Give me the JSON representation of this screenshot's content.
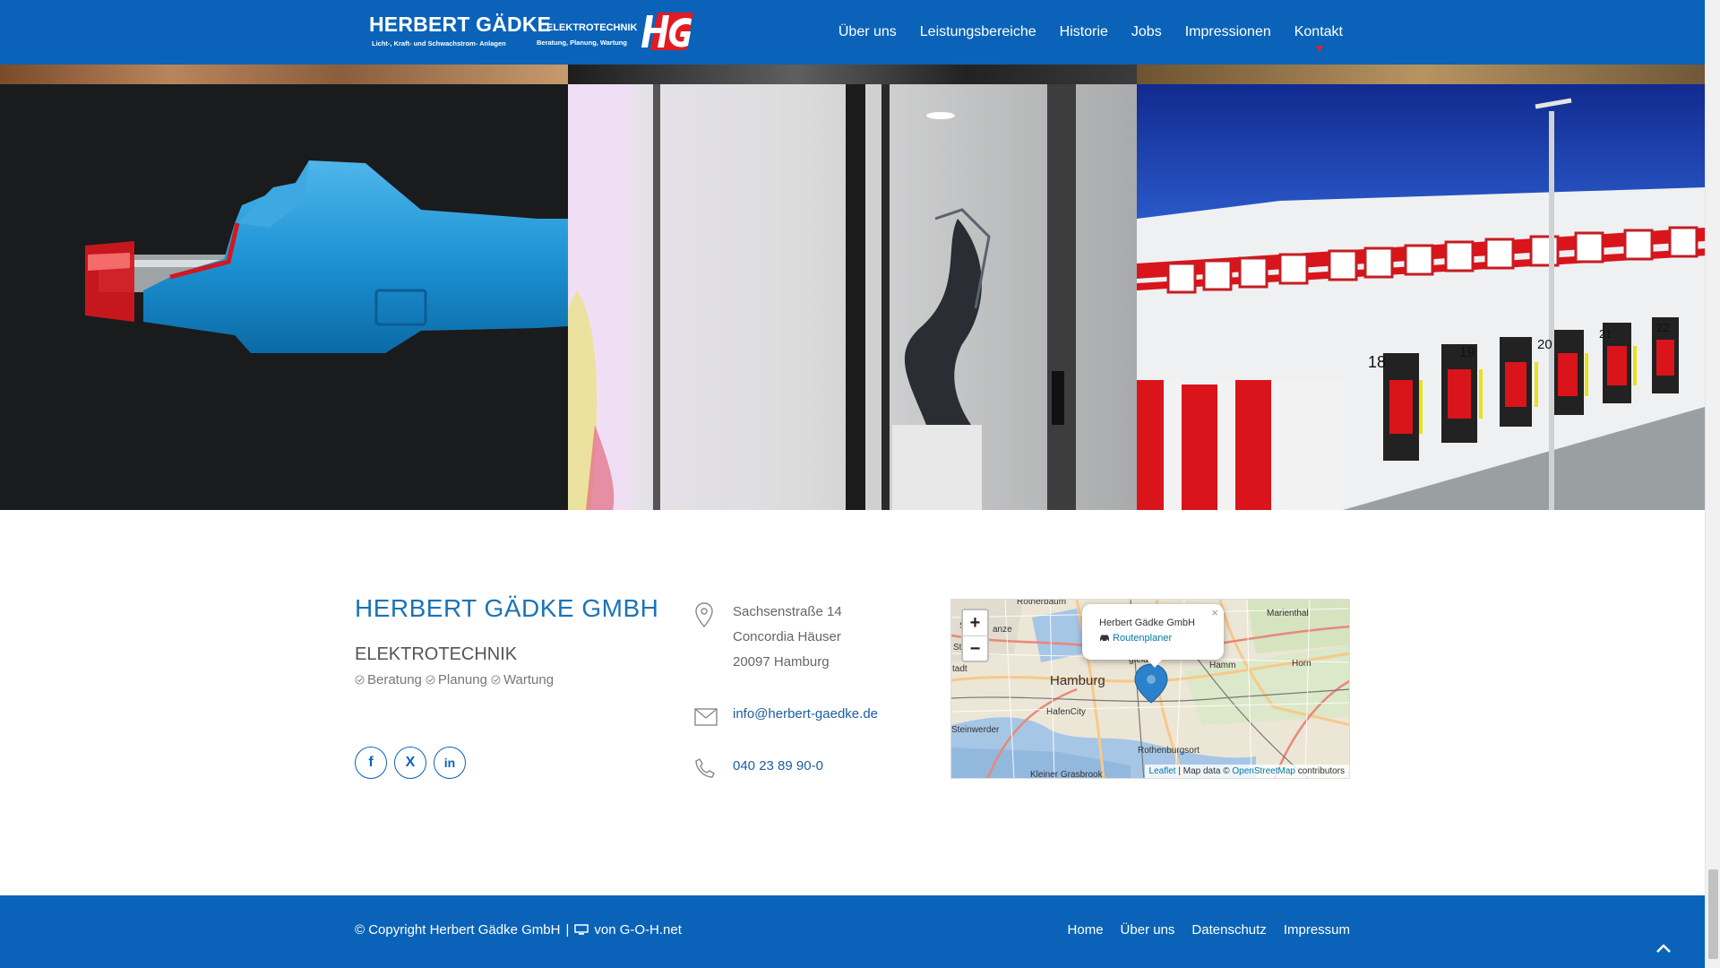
{
  "header": {
    "logo": {
      "brand": "HERBERT GÄDKE",
      "brand_sub": "Licht-, Kraft- und Schwachstrom- Anlagen",
      "elektro": "ELEKTROTECHNIK",
      "elektro_sub": "Beratung, Planung, Wartung"
    },
    "nav": [
      {
        "label": "Über uns",
        "active": false
      },
      {
        "label": "Leistungsbereiche",
        "active": false
      },
      {
        "label": "Historie",
        "active": false
      },
      {
        "label": "Jobs",
        "active": false
      },
      {
        "label": "Impressionen",
        "active": false
      },
      {
        "label": "Kontakt",
        "active": true
      }
    ],
    "accent": "#0a63b8",
    "active_marker_color": "#e02323"
  },
  "gallery": {
    "dock_numbers": [
      "18",
      "19",
      "20",
      "21",
      "22"
    ]
  },
  "footer": {
    "company_name": "HERBERT GÄDKE GMBH",
    "subtitle": "ELEKTROTECHNIK",
    "services": [
      "Beratung",
      "Planung",
      "Wartung"
    ],
    "socials": [
      {
        "name": "facebook",
        "glyph": "f"
      },
      {
        "name": "xing",
        "glyph": "X"
      },
      {
        "name": "linkedin",
        "glyph": "in"
      }
    ],
    "address": [
      "Sachsenstraße 14",
      "Concordia Häuser",
      "20097 Hamburg"
    ],
    "email": "info@herbert-gaedke.de",
    "phone": "040 23 89 90-0",
    "map": {
      "popup_title": "Herbert Gädke GmbH",
      "popup_link": "Routenplaner",
      "zoom_in": "+",
      "zoom_out": "−",
      "close": "×",
      "labels": {
        "rotherbaum": "Rotherbaum",
        "marienthal": "Marienthal",
        "hamm": "Hamm",
        "horn": "Horn",
        "hamburg": "Hamburg",
        "hafencity": "HafenCity",
        "steinwerder": "Steinwerder",
        "rothenburgsort": "Rothenburgsort",
        "kleiner": "Kleiner Grasbrook",
        "stpauli": "St. Pauli",
        "st": "St",
        "anze": "anze",
        "tadt": "tadt",
        "gfelde": "gfelde"
      },
      "attribution": {
        "leaflet": "Leaflet",
        "sep1": " | Map data © ",
        "osm": "OpenStreetMap",
        "contrib": " contributors"
      }
    }
  },
  "bottom": {
    "copyright": "© Copyright Herbert Gädke GmbH",
    "sep": "|",
    "by": "von G-O-H.net",
    "nav": [
      "Home",
      "Über uns",
      "Datenschutz",
      "Impressum"
    ]
  }
}
